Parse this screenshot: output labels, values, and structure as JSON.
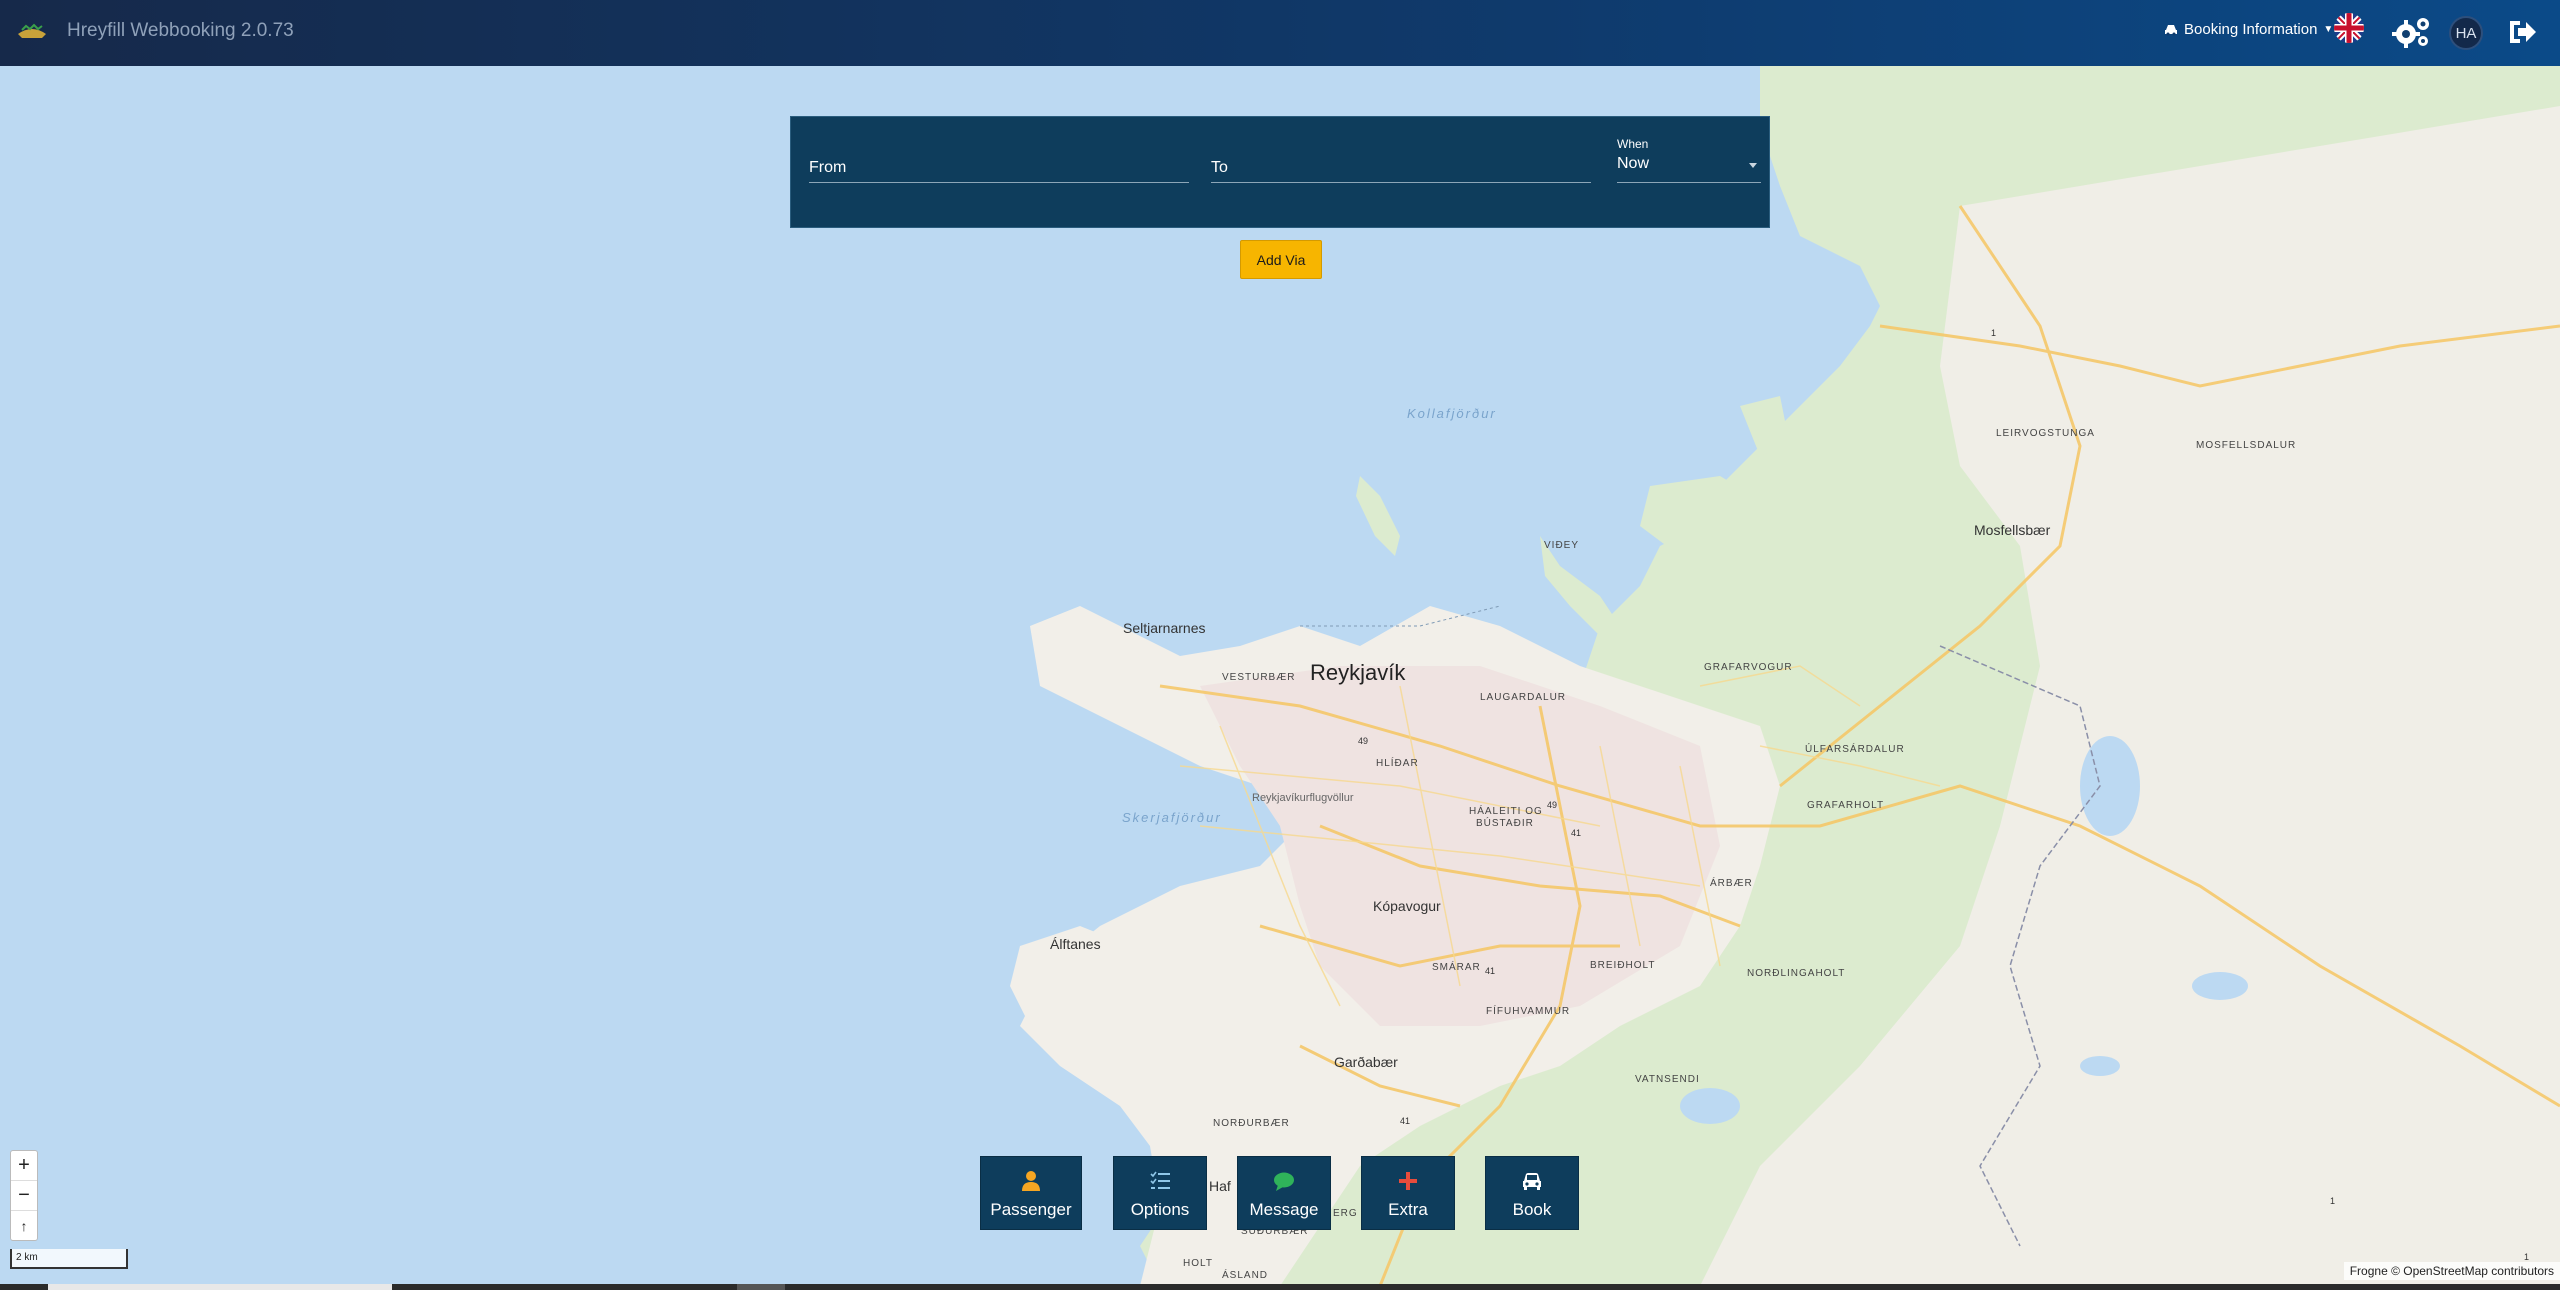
{
  "header": {
    "app_title": "Hreyfill Webbooking 2.0.73",
    "booking_info_label": "Booking Information",
    "avatar_initials": "HA"
  },
  "search": {
    "from_label": "From",
    "to_label": "To",
    "when_label": "When",
    "when_value": "Now",
    "add_via_label": "Add Via"
  },
  "actions": {
    "passenger": "Passenger",
    "options": "Options",
    "message": "Message",
    "extra": "Extra",
    "book": "Book"
  },
  "map": {
    "zoom_in": "+",
    "zoom_out": "−",
    "reset": "↑",
    "scale": "2 km",
    "attribution": "Frogne © OpenStreetMap contributors",
    "labels": {
      "reykjavik": "Reykjavík",
      "seltjarnarnes": "Seltjarnarnes",
      "kopavogur": "Kópavogur",
      "gardabaer": "Garðabær",
      "alftanes": "Álftanes",
      "mosfellsbaer": "Mosfellsbær",
      "vesturbaer": "VESTURBÆR",
      "laugardalur": "LAUGARDALUR",
      "hlidar": "HLÍÐAR",
      "haaleiti": "HÁALEITI OG",
      "bustadir": "BÚSTAÐIR",
      "grafarvogur": "GRAFARVOGUR",
      "ulfarsardalur": "ÚLFARSÁRDALUR",
      "grafarholt": "GRAFARHOLT",
      "arbaer": "ÁRBÆR",
      "breidholt": "BREIÐHOLT",
      "nordlingaholt": "NORÐLINGAHOLT",
      "smarar": "SMÁRAR",
      "fifuhvammur": "FÍFUHVAMMUR",
      "vatnsendi": "VATNSENDI",
      "nordurbaer": "NORÐURBÆR",
      "sudurbaer": "SUÐURBÆR",
      "holt": "HOLT",
      "asland": "ÁSLAND",
      "leirvogstunga": "LEIRVOGSTUNGA",
      "mosfellsdalur": "MOSFELLSDALUR",
      "videy": "VIÐEY",
      "kollafjordur": "Kollafjörður",
      "skerjafjordur": "Skerjafjörður",
      "airport": "Reykjavíkurflugvöllur",
      "hafn": "Haf",
      "erg": "ERG",
      "road49a": "49",
      "road49b": "49",
      "road41a": "41",
      "road41b": "41",
      "road41c": "41",
      "road1a": "1",
      "road1b": "1",
      "road1c": "1"
    }
  },
  "colors": {
    "header_start": "#16294a",
    "header_end": "#0b4a88",
    "panel": "#0e3d5c",
    "accent": "#f7b500",
    "sea": "#bcd9f2",
    "land": "#f2efe9",
    "green": "#dcebcf"
  }
}
